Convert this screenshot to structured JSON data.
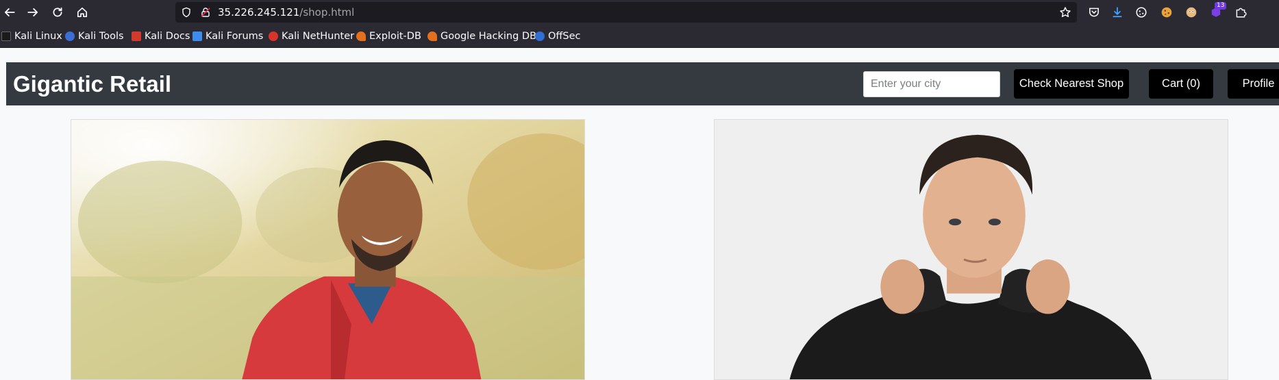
{
  "browser": {
    "url_host": "35.226.245.121",
    "url_path": "/shop.html",
    "extension_badge": "13",
    "bookmarks": [
      {
        "label": "Kali Linux",
        "icon": "kali-dragon-icon"
      },
      {
        "label": "Kali Tools",
        "icon": "kali-tools-icon"
      },
      {
        "label": "Kali Docs",
        "icon": "kali-docs-icon"
      },
      {
        "label": "Kali Forums",
        "icon": "kali-forums-icon"
      },
      {
        "label": "Kali NetHunter",
        "icon": "kali-nethunter-icon"
      },
      {
        "label": "Exploit-DB",
        "icon": "exploit-db-icon"
      },
      {
        "label": "Google Hacking DB",
        "icon": "ghdb-icon"
      },
      {
        "label": "OffSec",
        "icon": "offsec-icon"
      }
    ]
  },
  "header": {
    "title": "Gigantic Retail",
    "city_placeholder": "Enter your city",
    "check_shop_label": "Check Nearest Shop",
    "cart_label": "Cart (0)",
    "profile_label": "Profile"
  },
  "products": [
    {
      "image": "man-in-red-jacket-photo"
    },
    {
      "image": "man-in-black-hoodie-photo"
    }
  ],
  "colors": {
    "header_bg": "#343a40",
    "button_bg": "#000000",
    "page_bg": "#f8f9fa",
    "browser_chrome": "#2b2a33"
  }
}
